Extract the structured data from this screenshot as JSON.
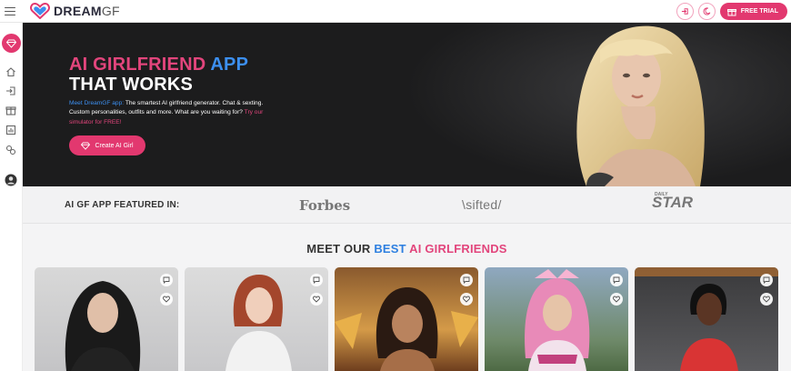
{
  "header": {
    "logo_text": "DREAM",
    "logo_suffix": "GF",
    "free_trial_label": "FREE TRIAL"
  },
  "sidebar": {
    "items": [
      "diamond-icon",
      "home-icon",
      "login-icon",
      "gift-icon",
      "chart-icon",
      "swap-icon",
      "avatar-icon"
    ]
  },
  "hero": {
    "title_part1": "AI GIRLFRIEND",
    "title_part2": "APP",
    "title_line2": "THAT WORKS",
    "desc_blue": "Meet DreamGF app:",
    "desc_main": "The smartest AI girlfriend generator. Chat & sexting. Custom personalities, outfits and more. What are you waiting for?",
    "desc_pink": "Try our simulator for FREE!",
    "cta_label": "Create AI Girl"
  },
  "featured": {
    "label": "AI GF APP FEATURED IN:",
    "logos": [
      "Forbes",
      "\\sifted/",
      "STAR"
    ],
    "star_small": "DAILY"
  },
  "section": {
    "title_prefix": "MEET OUR",
    "title_blue": "BEST",
    "title_pink": "AI GIRLFRIENDS"
  },
  "colors": {
    "accent": "#e2386f",
    "blue": "#3c8ff0",
    "hero_bg": "#1c1c1d"
  }
}
